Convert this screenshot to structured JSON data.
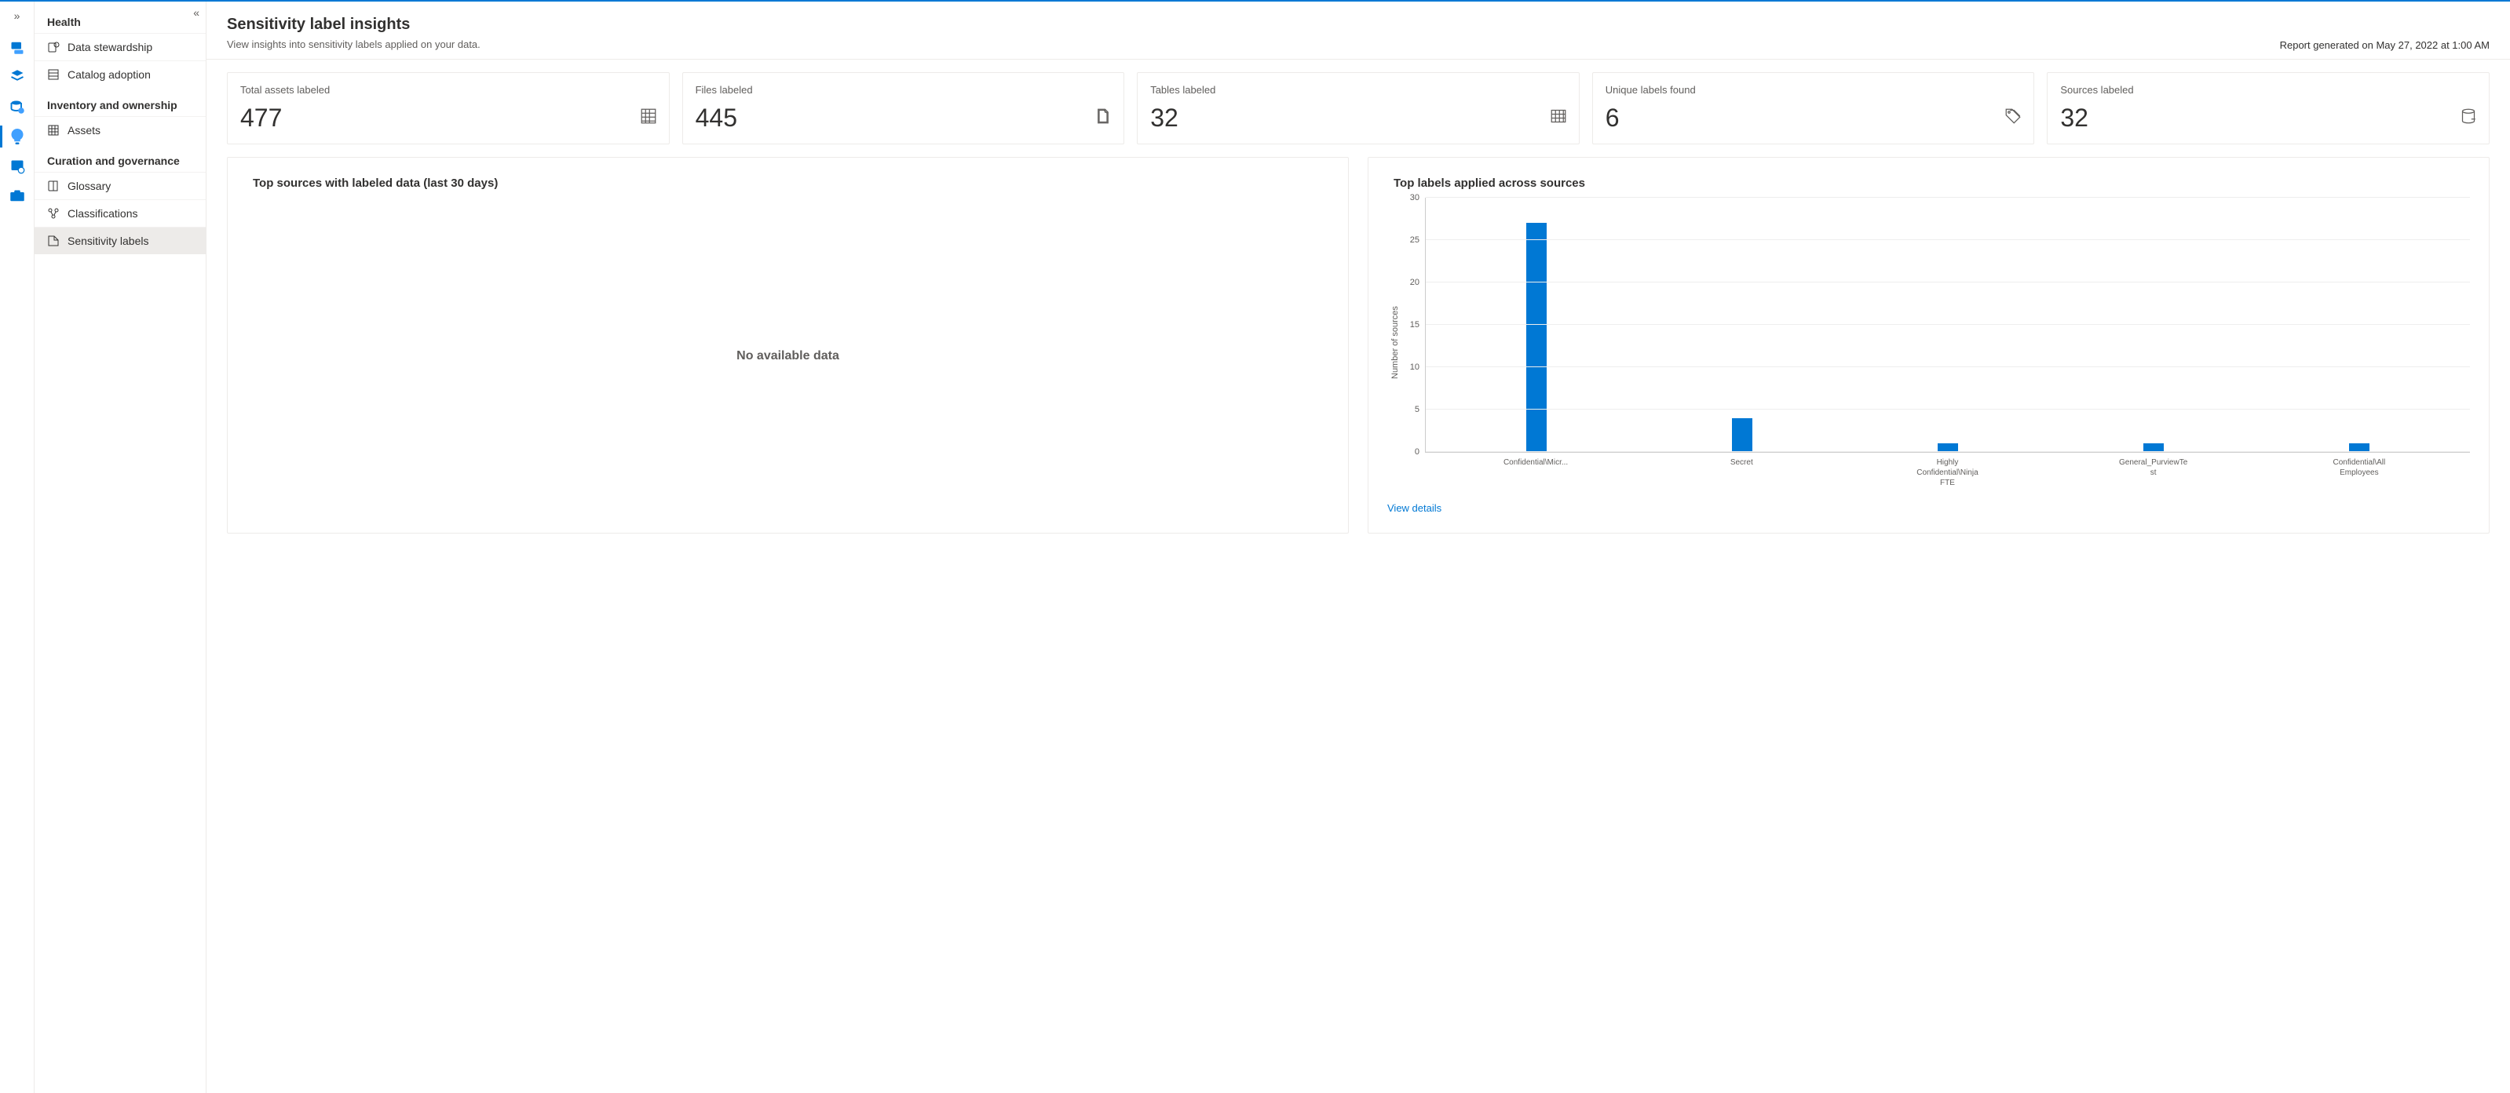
{
  "header": {
    "title": "Sensitivity label insights",
    "subtitle": "View insights into sensitivity labels applied on your data.",
    "report_timestamp": "Report generated on May 27, 2022 at 1:00 AM"
  },
  "sidebar": {
    "groups": [
      {
        "label": "Health",
        "items": [
          {
            "label": "Data stewardship"
          },
          {
            "label": "Catalog adoption"
          }
        ]
      },
      {
        "label": "Inventory and ownership",
        "items": [
          {
            "label": "Assets"
          }
        ]
      },
      {
        "label": "Curation and governance",
        "items": [
          {
            "label": "Glossary"
          },
          {
            "label": "Classifications"
          },
          {
            "label": "Sensitivity labels",
            "selected": true
          }
        ]
      }
    ]
  },
  "cards": [
    {
      "label": "Total assets labeled",
      "value": "477",
      "icon": "grid"
    },
    {
      "label": "Files labeled",
      "value": "445",
      "icon": "file"
    },
    {
      "label": "Tables labeled",
      "value": "32",
      "icon": "table"
    },
    {
      "label": "Unique labels found",
      "value": "6",
      "icon": "tag"
    },
    {
      "label": "Sources labeled",
      "value": "32",
      "icon": "db"
    }
  ],
  "panels": {
    "left": {
      "title": "Top sources with labeled data (last 30 days)",
      "empty": "No available data"
    },
    "right": {
      "title": "Top labels applied across sources",
      "view_details": "View details"
    }
  },
  "chart_data": {
    "type": "bar",
    "categories": [
      "Confidential\\Micr...",
      "Secret",
      "Highly Confidential\\Ninja FTE",
      "General_PurviewTest",
      "Confidential\\All Employees"
    ],
    "values": [
      27,
      4,
      1,
      1,
      1
    ],
    "ylabel": "Number of sources",
    "ylim": [
      0,
      30
    ],
    "yticks": [
      0,
      5,
      10,
      15,
      20,
      25,
      30
    ]
  }
}
